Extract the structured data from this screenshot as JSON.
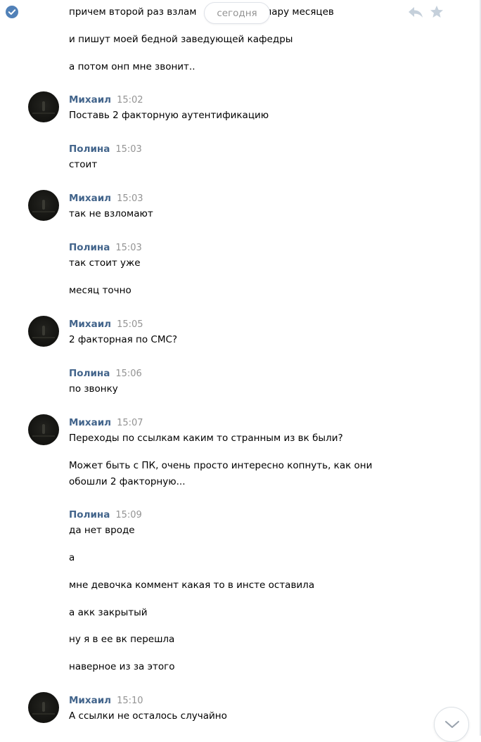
{
  "date_divider": "сегодня",
  "messages": [
    {
      "texts": [
        "причем второй раз взлам",
        "пару месяцев"
      ]
    },
    {
      "texts": [
        "и пишут моей бедной заведующей кафедры"
      ]
    },
    {
      "texts": [
        "а потом онп мне звонит.."
      ]
    }
  ],
  "groups": [
    {
      "author": "Михаил",
      "time": "15:02",
      "lines": [
        "Поставь 2 факторную аутентификацию"
      ]
    },
    {
      "author": "Полина",
      "time": "15:03",
      "lines": [
        "стоит"
      ]
    },
    {
      "author": "Михаил",
      "time": "15:03",
      "lines": [
        "так не взломают"
      ]
    },
    {
      "author": "Полина",
      "time": "15:03",
      "lines": [
        "так стоит уже",
        "месяц точно"
      ]
    },
    {
      "author": "Михаил",
      "time": "15:05",
      "lines": [
        "2 факторная по СМС?"
      ]
    },
    {
      "author": "Полина",
      "time": "15:06",
      "lines": [
        "по звонку"
      ]
    },
    {
      "author": "Михаил",
      "time": "15:07",
      "lines": [
        "Переходы по ссылкам каким то странным из вк были?",
        "Может быть с ПК, очень просто интересно копнуть, как они",
        "обошли 2 факторную..."
      ]
    },
    {
      "author": "Полина",
      "time": "15:09",
      "lines": [
        "да нет вроде",
        "а",
        "мне девочка коммент какая то в инсте оставила",
        "а акк закрытый",
        "ну я в ее вк перешла",
        "наверное из за этого"
      ]
    },
    {
      "author": "Михаил",
      "time": "15:10",
      "lines": [
        "А ссылки не осталось случайно"
      ]
    }
  ],
  "icons": {
    "check": "check-circle-icon",
    "reply": "reply-icon",
    "star": "star-icon",
    "scroll": "chevron-down-icon"
  },
  "colors": {
    "author": "#42648b",
    "time": "#939393",
    "check": "#5181b8",
    "icon_gray": "#c5d0db"
  }
}
